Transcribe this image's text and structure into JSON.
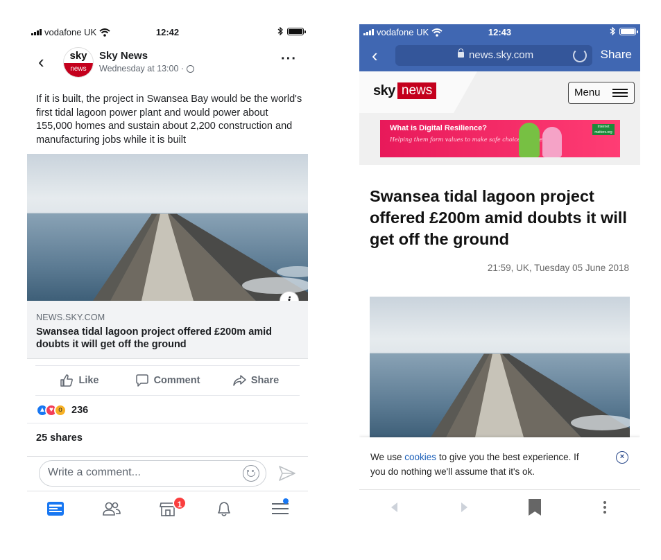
{
  "facebook": {
    "status": {
      "carrier": "vodafone UK",
      "time": "12:42"
    },
    "post": {
      "page_name": "Sky News",
      "avatar_top": "sky",
      "avatar_bottom": "news",
      "timestamp": "Wednesday at 13:00 ·",
      "more_label": "···",
      "text": "If it is built, the project in Swansea Bay would be the world's first tidal lagoon power plant and would power about 155,000 homes and sustain about 2,200 construction and manufacturing jobs while it is built",
      "info_label": "i",
      "link": {
        "domain": "NEWS.SKY.COM",
        "title": "Swansea tidal lagoon project offered £200m amid doubts it will get off the ground"
      }
    },
    "actions": {
      "like": "Like",
      "comment": "Comment",
      "share": "Share"
    },
    "reactions": {
      "count": "236",
      "types": [
        "like",
        "love",
        "wow"
      ]
    },
    "shares": "25 shares",
    "comment": {
      "placeholder": "Write a comment..."
    },
    "tabbar": {
      "notifications_badge": "1",
      "tabs": [
        "news-feed",
        "friends",
        "marketplace",
        "notifications",
        "menu"
      ]
    }
  },
  "safari": {
    "status": {
      "carrier": "vodafone UK",
      "time": "12:43"
    },
    "nav": {
      "url": "news.sky.com",
      "share_label": "Share",
      "color": "#4067b2"
    },
    "site": {
      "logo_sky": "sky",
      "logo_news": "news",
      "menu_label": "Menu",
      "ad": {
        "headline": "What is Digital Resilience?",
        "subline": "Helping them form values to make safe choices online",
        "sponsor": "Internet matters.org"
      }
    },
    "article": {
      "headline": "Swansea tidal lagoon project offered £200m amid doubts it will get off the ground",
      "date": "21:59, UK, Tuesday 05 June 2018"
    },
    "cookie": {
      "before": "We use ",
      "link": "cookies",
      "after": " to give you the best experience. If you do nothing we'll assume that it's ok.",
      "close_label": "×"
    }
  },
  "colors": {
    "facebook_blue": "#1877f2",
    "sky_red": "#c4001d",
    "safari_nav": "#4067b2"
  }
}
